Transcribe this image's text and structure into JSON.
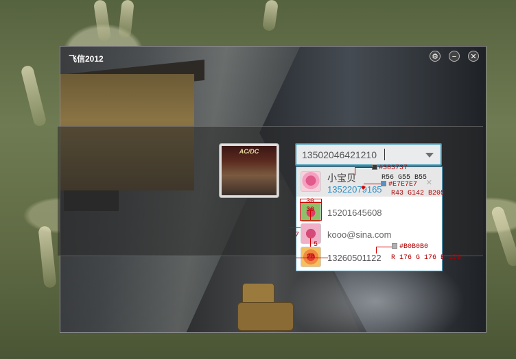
{
  "window": {
    "title": "飞信2012"
  },
  "titlebar_buttons": {
    "settings_icon": "gear-icon",
    "settings_glyph": "⚙",
    "minimize_icon": "minimize-icon",
    "minimize_glyph": "−",
    "close_icon": "close-icon",
    "close_glyph": "✕"
  },
  "account": {
    "value": "13502046421210",
    "dropdown_icon": "chevron-down-icon",
    "accent_color": "#2d95b7"
  },
  "avatar": {
    "logo_text": "AC/DC"
  },
  "dropdown": {
    "items": [
      {
        "name": "小宝贝",
        "number": "13522079165",
        "remove": "✕"
      },
      {
        "text": "15201645608"
      },
      {
        "text": "kooo@sina.com"
      },
      {
        "text": "13260501122"
      }
    ]
  },
  "annotations": {
    "name_color_hex": "#383737",
    "name_color_rgb": "R56 G55 B55",
    "selected_bg_hex": "#E7E7E7",
    "selected_bg_rgb": "R43 G142 B205",
    "close_color_hex": "#B0B0B0",
    "close_color_rgb": "R 176 G 176 B 176",
    "thumb_width": "30",
    "thumb_height": "30",
    "left_margin": "7",
    "gap": "5",
    "row_height": "28"
  },
  "colors": {
    "name": "#383737",
    "number_blue": "#2b8ec5",
    "selected_bg": "#E7E7E7",
    "close_gray": "#B0B0B0",
    "annotation_red": "#d40000"
  }
}
